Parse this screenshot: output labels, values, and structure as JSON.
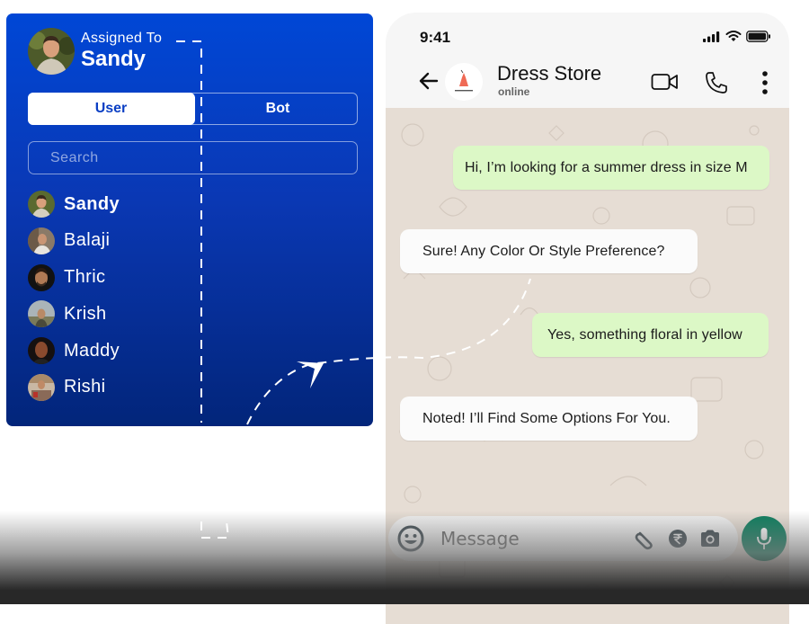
{
  "panel": {
    "assigned_label": "Assigned To",
    "assigned_name": "Sandy",
    "tabs": [
      {
        "label": "User",
        "active": true
      },
      {
        "label": "Bot",
        "active": false
      }
    ],
    "search_placeholder": "Search",
    "users": [
      {
        "name": "Sandy",
        "active": true
      },
      {
        "name": "Balaji",
        "active": false
      },
      {
        "name": "Thric",
        "active": false
      },
      {
        "name": "Krish",
        "active": false
      },
      {
        "name": "Maddy",
        "active": false
      },
      {
        "name": "Rishi",
        "active": false
      }
    ],
    "colors": {
      "gradient_top": "#0047d6",
      "gradient_bottom": "#02257a",
      "active_tab_text": "#0b3fc4"
    }
  },
  "phone": {
    "status_bar": {
      "time": "9:41",
      "icons": [
        "signal-icon",
        "wifi-icon",
        "battery-icon"
      ]
    },
    "header": {
      "contact_name": "Dress Store",
      "contact_status": "online",
      "icons": [
        "back-arrow-icon",
        "video-call-icon",
        "voice-call-icon",
        "more-options-icon"
      ]
    },
    "messages": [
      {
        "direction": "outgoing",
        "text": "Hi, I’m looking for a summer dress in size M"
      },
      {
        "direction": "incoming",
        "text": "Sure! Any Color Or Style Preference?"
      },
      {
        "direction": "outgoing",
        "text": "Yes, something floral in yellow"
      },
      {
        "direction": "incoming",
        "text": "Noted! I’ll Find Some Options For You."
      }
    ],
    "composer": {
      "placeholder": "Message",
      "icons": [
        "emoji-icon",
        "attachment-icon",
        "rupee-payment-icon",
        "camera-icon",
        "microphone-icon"
      ]
    },
    "colors": {
      "outgoing_bubble": "#dcf8c6",
      "incoming_bubble": "#fbfbfb",
      "chat_bg": "#e6ddd4",
      "mic_button": "#0b7d5d"
    }
  }
}
